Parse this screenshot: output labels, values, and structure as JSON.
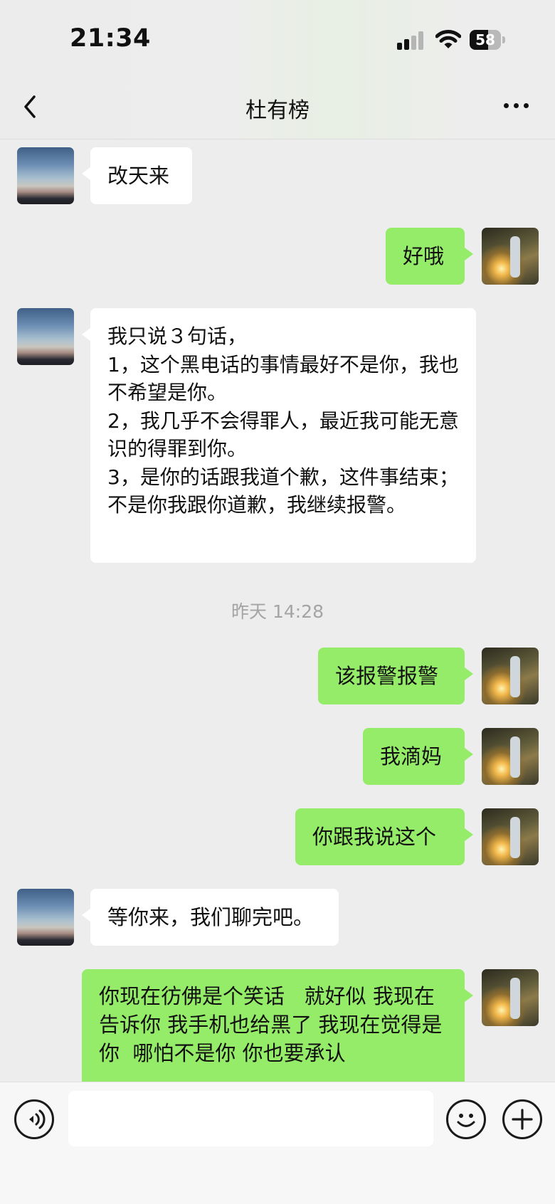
{
  "status_bar": {
    "time": "21:34",
    "battery": "58",
    "battery_level": 0.58
  },
  "header": {
    "title": "杜有榜"
  },
  "messages": [
    {
      "text": "改天来",
      "side": "in"
    },
    {
      "text": "好哦",
      "side": "out"
    },
    {
      "text": "我只说３句话，\n1，这个黑电话的事情最好不是你，我也不希望是你。\n2，我几乎不会得罪人，最近我可能无意识的得罪到你。\n3，是你的话跟我道个歉，这件事结束；不是你我跟你道歉，我继续报警。",
      "side": "in"
    },
    {
      "text": "该报警报警",
      "side": "out"
    },
    {
      "text": "我滴妈",
      "side": "out"
    },
    {
      "text": "你跟我说这个",
      "side": "out"
    },
    {
      "text": "等你来，我们聊完吧。",
      "side": "in"
    },
    {
      "text": "你现在彷佛是个笑话   就好似 我现在告诉你 我手机也给黑了 我现在觉得是你  哪怕不是你 你也要承认",
      "side": "out"
    }
  ],
  "timestamp": "昨天 14:28",
  "input_bar": {
    "input_value": ""
  },
  "colors": {
    "outgoing_bubble": "#95ec69",
    "incoming_bubble": "#ffffff",
    "background": "#ededed"
  }
}
